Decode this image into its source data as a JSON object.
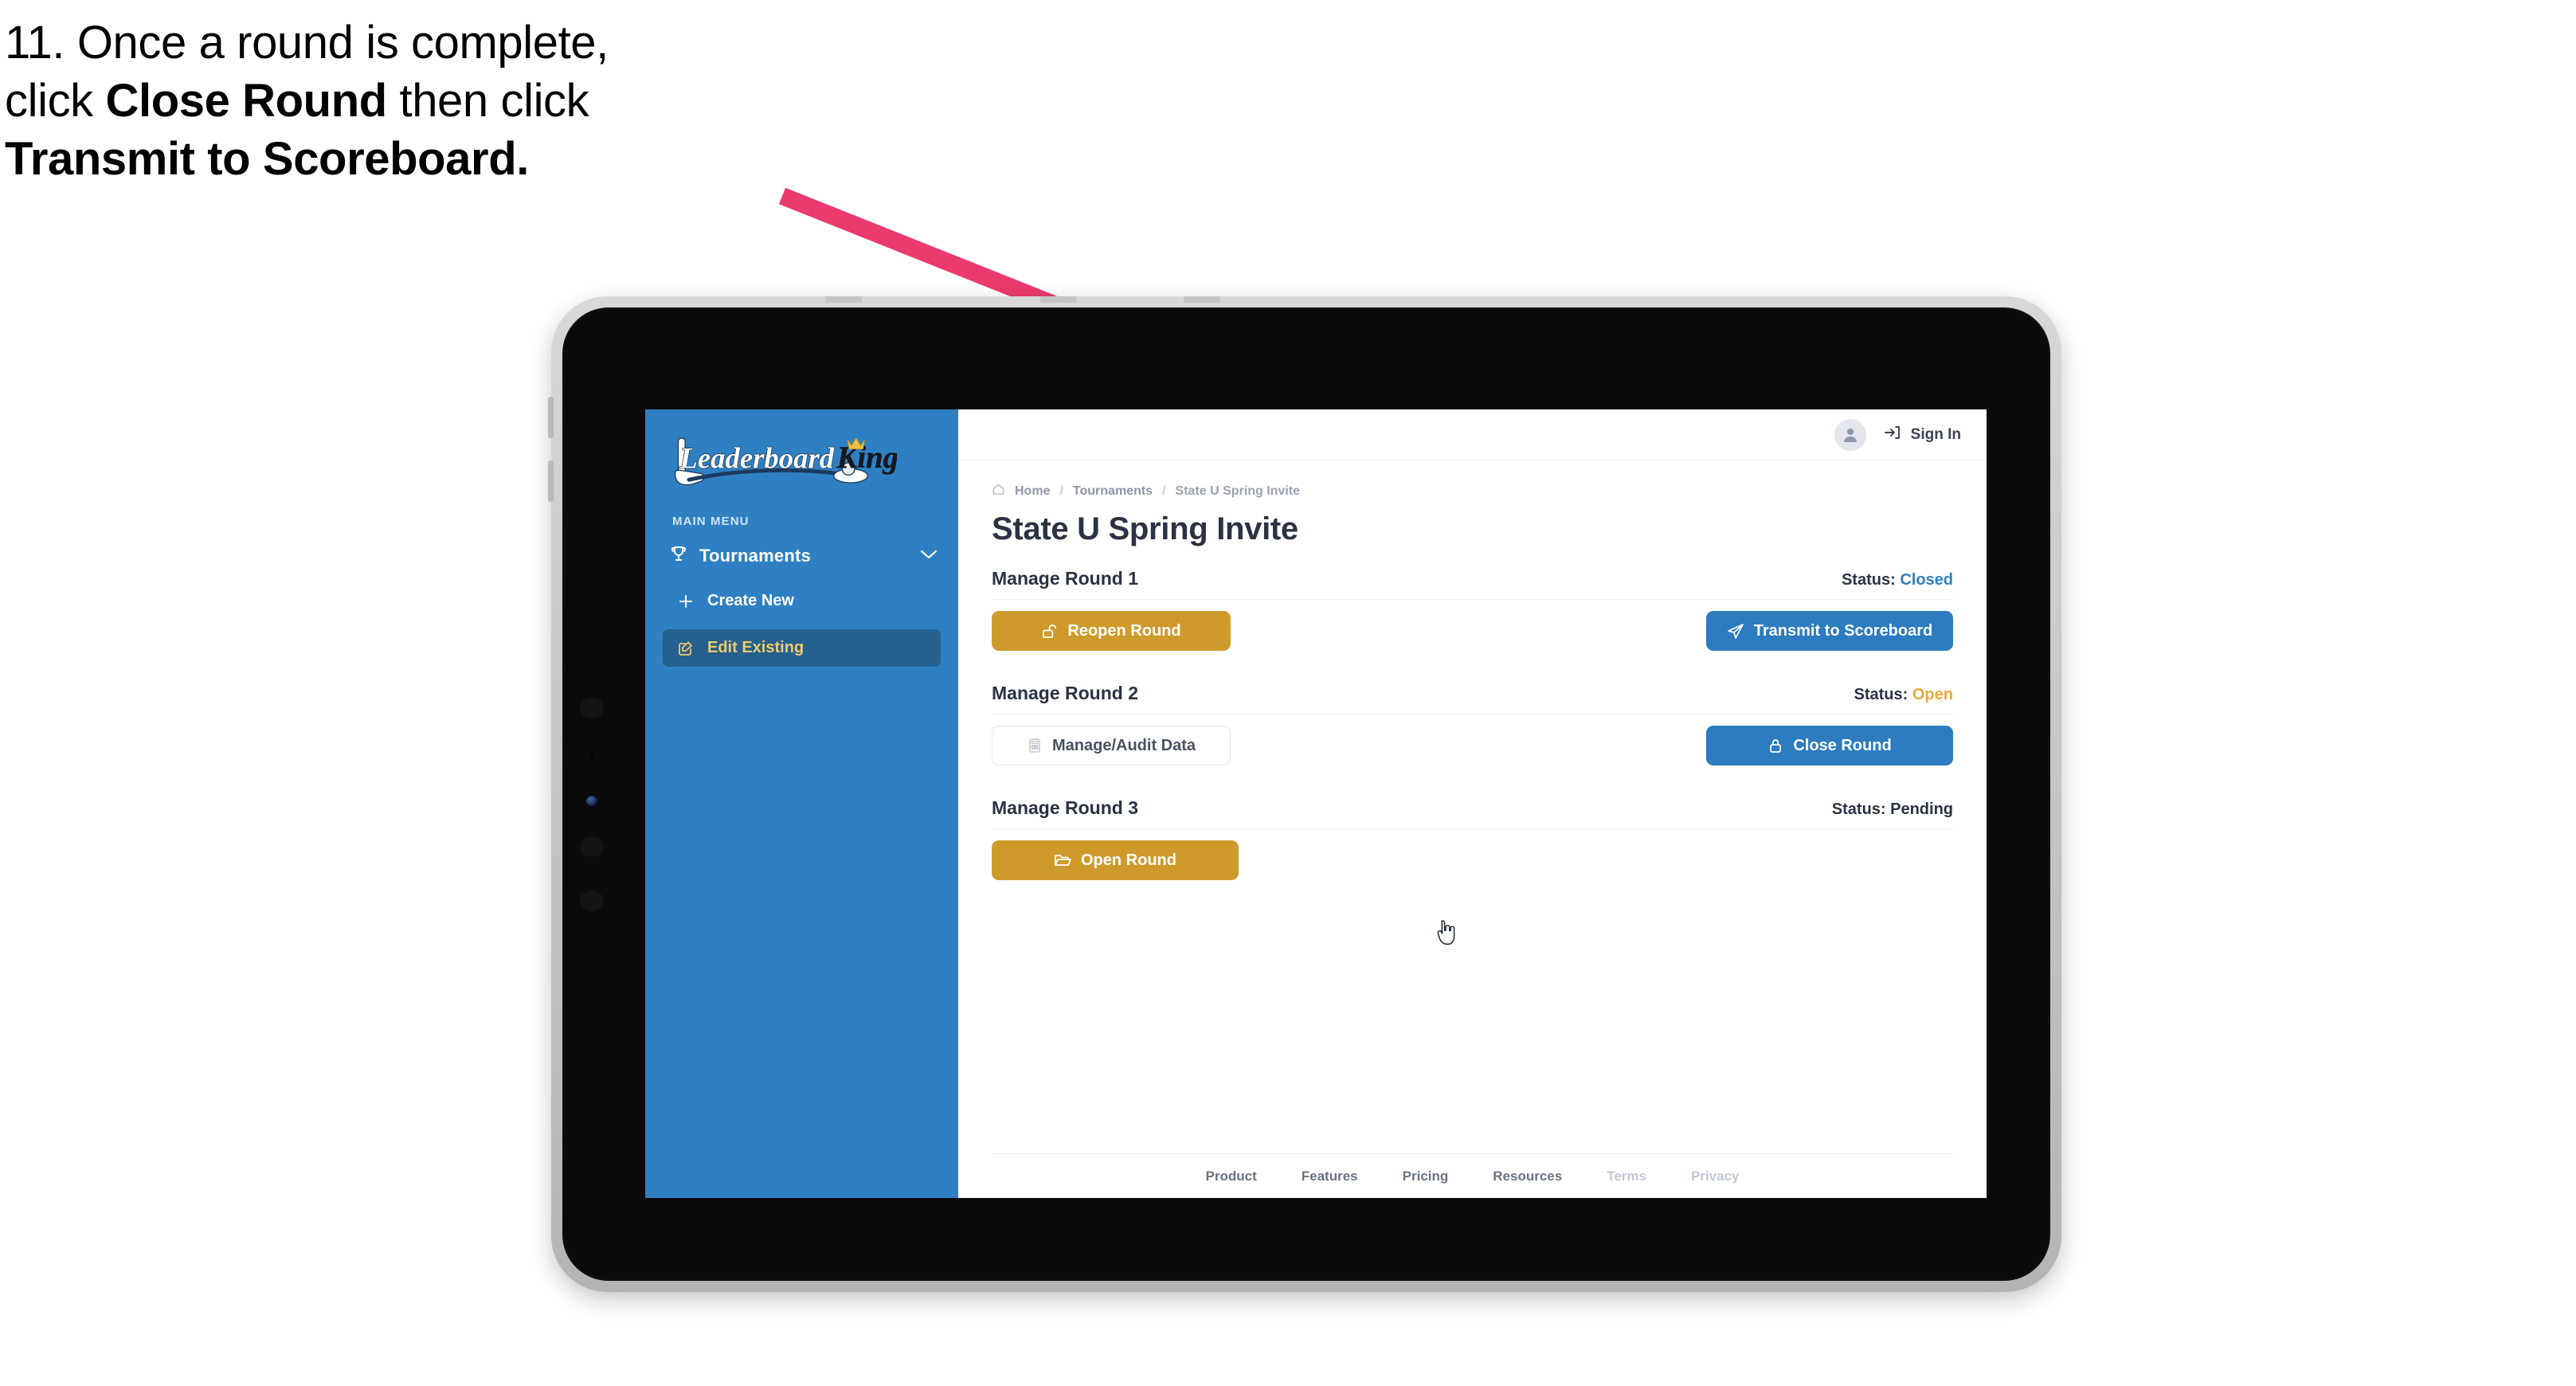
{
  "caption": {
    "line1_pre": "11. Once a round is complete,",
    "line2_pre": "click ",
    "line2_bold": "Close Round",
    "line2_post": " then click",
    "line3_bold": "Transmit to Scoreboard."
  },
  "annotation": {
    "arrow_color": "#ea3a6e",
    "arrow_name": "pointer-arrow"
  },
  "device": {
    "type": "tablet",
    "frame_color": "#c8c8c8",
    "bezel_color": "#0a0a0a"
  },
  "sidebar": {
    "brand": "LeaderboardKing",
    "brand_word_1": "Leaderboard",
    "brand_word_2": "King",
    "bg_color": "#2f80c2",
    "section_label": "MAIN MENU",
    "items": [
      {
        "label": "Tournaments",
        "icon": "trophy-icon",
        "expanded": true,
        "chevron": "chevron-down-icon"
      }
    ],
    "subitems": [
      {
        "label": "Create New",
        "icon": "plus-icon",
        "active": false
      },
      {
        "label": "Edit Existing",
        "icon": "edit-square-icon",
        "active": true
      }
    ]
  },
  "topbar": {
    "avatar_icon": "user-avatar-icon",
    "signin_icon": "sign-in-icon",
    "signin_label": "Sign In"
  },
  "breadcrumb": {
    "home_icon": "home-icon",
    "items": [
      "Home",
      "Tournaments",
      "State U Spring Invite"
    ],
    "separator": "/"
  },
  "page": {
    "title": "State U Spring Invite"
  },
  "rounds": [
    {
      "title": "Manage Round 1",
      "status_label": "Status:",
      "status_value": "Closed",
      "status_kind": "closed",
      "status_color": "#2f80c2",
      "left_button": {
        "label": "Reopen Round",
        "icon": "unlock-icon",
        "style": "amber",
        "color": "#cf9a2c"
      },
      "right_button": {
        "label": "Transmit to Scoreboard",
        "icon": "paper-plane-icon",
        "style": "blue",
        "color": "#2c7cbf"
      }
    },
    {
      "title": "Manage Round 2",
      "status_label": "Status:",
      "status_value": "Open",
      "status_kind": "open",
      "status_color": "#e5a93a",
      "left_button": {
        "label": "Manage/Audit Data",
        "icon": "calculator-icon",
        "style": "ghost",
        "color": "#ffffff"
      },
      "right_button": {
        "label": "Close Round",
        "icon": "lock-icon",
        "style": "blue",
        "color": "#2c7cbf"
      }
    },
    {
      "title": "Manage Round 3",
      "status_label": "Status:",
      "status_value": "Pending",
      "status_kind": "pending",
      "status_color": "#2c3244",
      "left_button": {
        "label": "Open Round",
        "icon": "folder-open-icon",
        "style": "amber",
        "color": "#cf9a2c"
      },
      "right_button": null
    }
  ],
  "footer": {
    "links": [
      {
        "label": "Product",
        "muted": false
      },
      {
        "label": "Features",
        "muted": false
      },
      {
        "label": "Pricing",
        "muted": false
      },
      {
        "label": "Resources",
        "muted": false
      },
      {
        "label": "Terms",
        "muted": true
      },
      {
        "label": "Privacy",
        "muted": true
      }
    ]
  },
  "cursor": {
    "type": "pointer-hand-cursor"
  }
}
